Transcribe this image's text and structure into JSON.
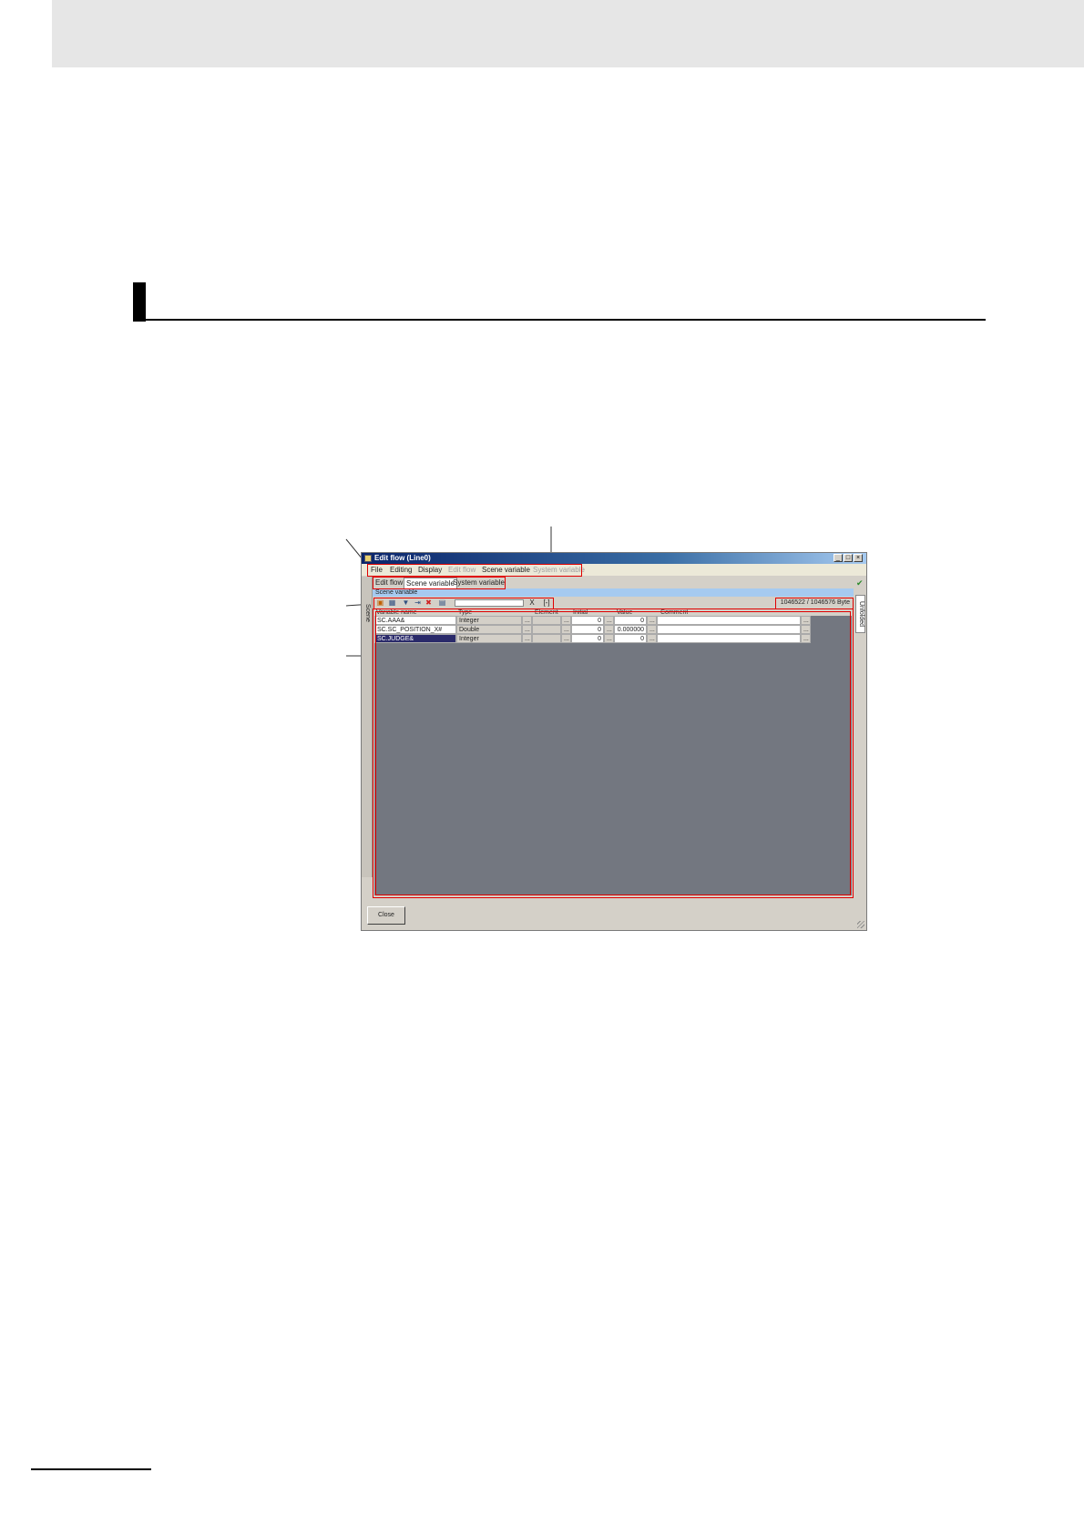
{
  "window": {
    "title": "Edit flow (Line0)",
    "menu": [
      {
        "label": "File",
        "enabled": true
      },
      {
        "label": "Editing",
        "enabled": true
      },
      {
        "label": "Display",
        "enabled": true
      },
      {
        "label": "Edit flow",
        "enabled": false
      },
      {
        "label": "Scene variable",
        "enabled": true
      },
      {
        "label": "System variable",
        "enabled": false
      }
    ],
    "tabs": [
      "Edit flow",
      "Scene variable",
      "System variable"
    ],
    "scene_bar": "Scene variable",
    "left_tab": "Scene",
    "right_tab": "Unfolded",
    "byte_counter": "1046522 / 1046576 Byte",
    "toolbar_x": "X",
    "toolbar_btn": "[-]",
    "grid": {
      "headers": [
        "Variable name",
        "Type",
        "Element",
        "Initial",
        "Value",
        "Comment"
      ],
      "rows": [
        {
          "name": "SC.AAA&",
          "type": "Integer",
          "initial": "0",
          "value": "0",
          "dots": "..."
        },
        {
          "name": "SC.SC_POSITION_X#",
          "type": "Double",
          "initial": "0",
          "value": "0.000000",
          "dots": "..."
        },
        {
          "name": "SC.JUDGE&",
          "type": "Integer",
          "initial": "0",
          "value": "0",
          "dots": "..."
        }
      ]
    },
    "close_label": "Close"
  }
}
